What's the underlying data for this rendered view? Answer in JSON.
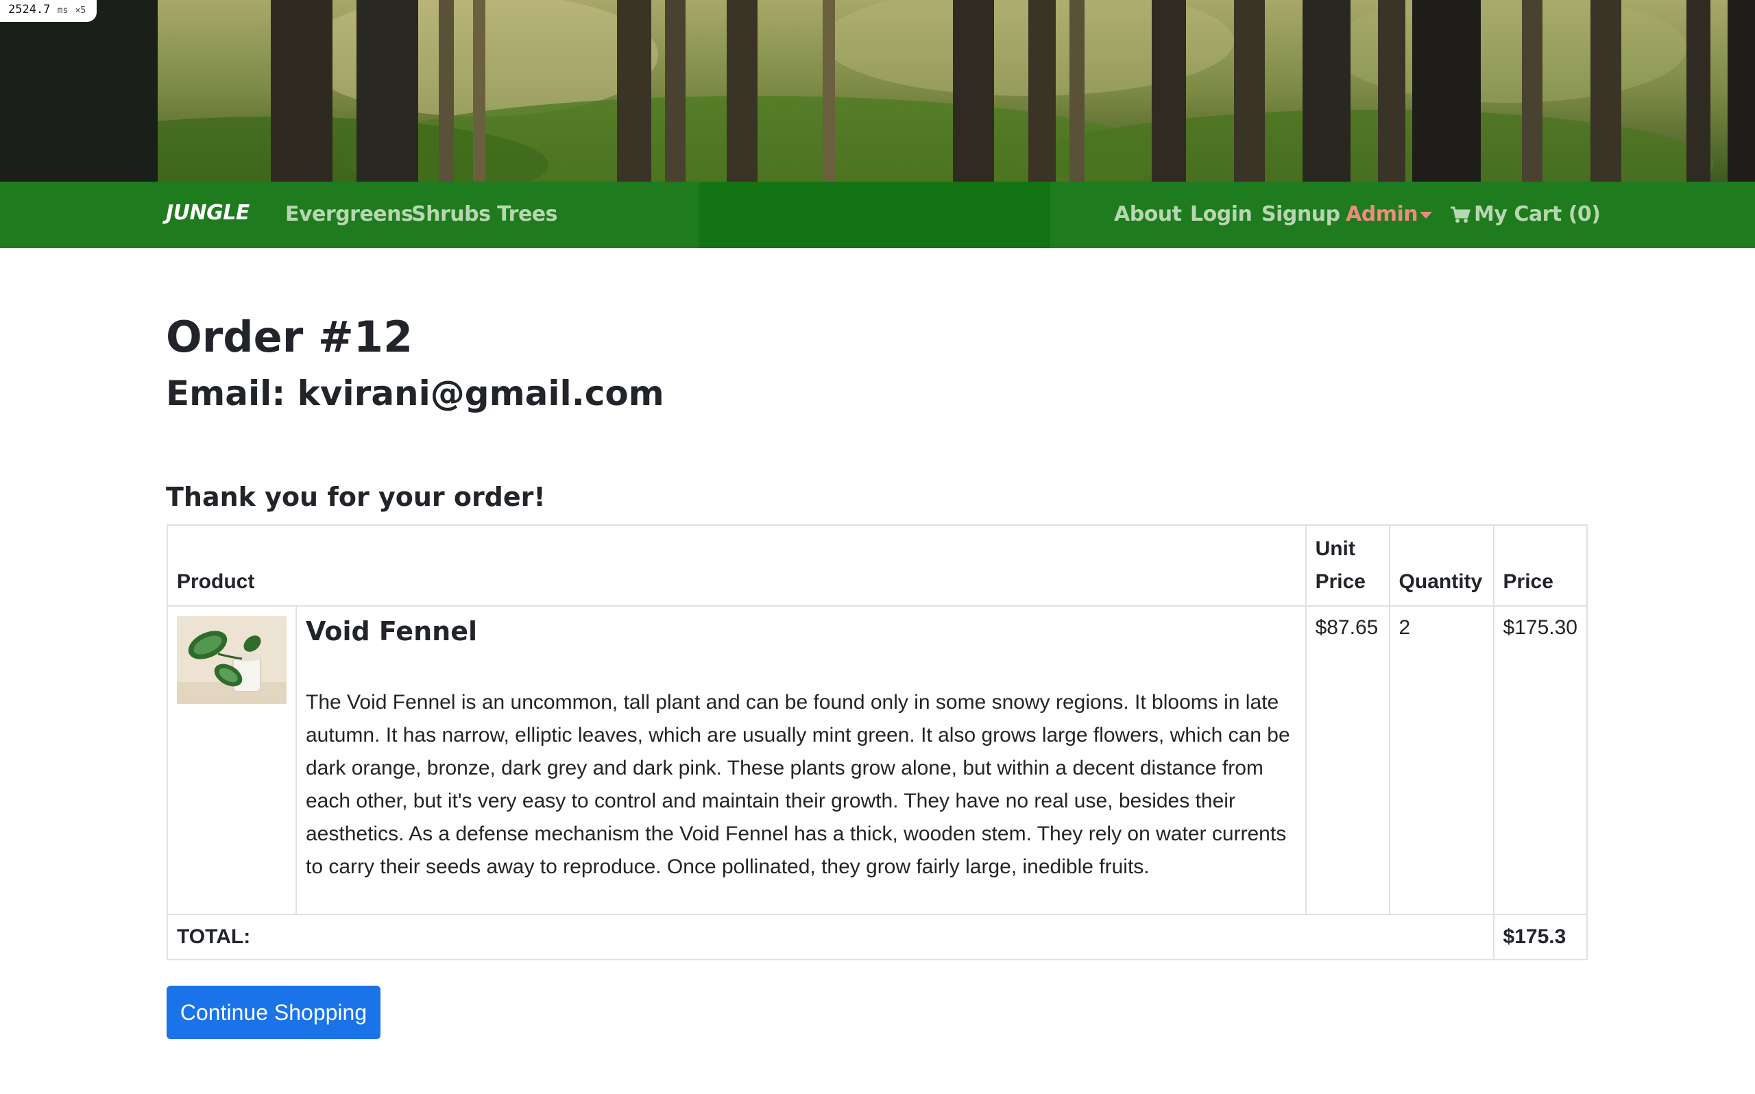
{
  "overlay": {
    "timing": "2524.7",
    "unit": "ms",
    "multiplier": "×5"
  },
  "nav": {
    "brand": "JUNGLE",
    "left_links": [
      "Evergreens",
      "Shrubs",
      "Trees"
    ],
    "right_links": [
      "About",
      "Login",
      "Signup"
    ],
    "admin_label": "Admin",
    "cart_label": "My Cart (0)"
  },
  "order": {
    "title": "Order #12",
    "email_line": "Email: kvirani@gmail.com",
    "thank_you": "Thank you for your order!"
  },
  "table": {
    "headers": {
      "product": "Product",
      "unit_price_1": "Unit",
      "unit_price_2": "Price",
      "quantity": "Quantity",
      "price": "Price"
    },
    "rows": [
      {
        "name": "Void Fennel",
        "description": "The Void Fennel is an uncommon, tall plant and can be found only in some snowy regions. It blooms in late autumn. It has narrow, elliptic leaves, which are usually mint green. It also grows large flowers, which can be dark orange, bronze, dark grey and dark pink. These plants grow alone, but within a decent distance from each other, but it's very easy to control and maintain their growth. They have no real use, besides their aesthetics. As a defense mechanism the Void Fennel has a thick, wooden stem. They rely on water currents to carry their seeds away to reproduce. Once pollinated, they grow fairly large, inedible fruits.",
        "unit_price": "$87.65",
        "quantity": "2",
        "price": "$175.30"
      }
    ],
    "total_label": "TOTAL:",
    "total_value": "$175.3"
  },
  "actions": {
    "continue_label": "Continue Shopping"
  },
  "colors": {
    "navbar": "#1e7b1e",
    "admin": "#f08a80",
    "button": "#1a73e8"
  },
  "icons": {
    "cart": "cart-icon",
    "admin_caret": "caret-down-icon",
    "product_image": "plant-photo"
  }
}
